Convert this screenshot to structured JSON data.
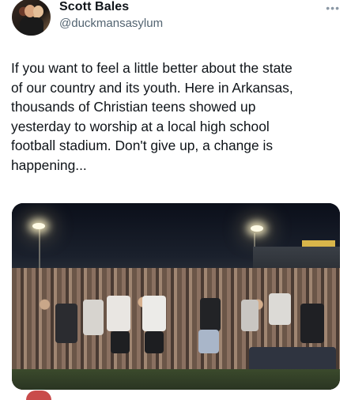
{
  "author": {
    "name": "Scott Bales",
    "handle": "@duckmansasylum",
    "avatar_icon": "profile-photo"
  },
  "more_icon": "more-options-icon",
  "tweet": {
    "lines": [
      "If you want to feel a little better about the state",
      "of our country and its youth.  Here in Arkansas,",
      "thousands of Christian teens showed up",
      "yesterday to worship at a local high school",
      "football stadium.  Don't give up, a change is",
      "happening..."
    ]
  },
  "media": {
    "description_icon": "stadium-crowd-photo"
  },
  "colors": {
    "text": "#0f1419",
    "secondary": "#536471",
    "background": "#ffffff"
  }
}
